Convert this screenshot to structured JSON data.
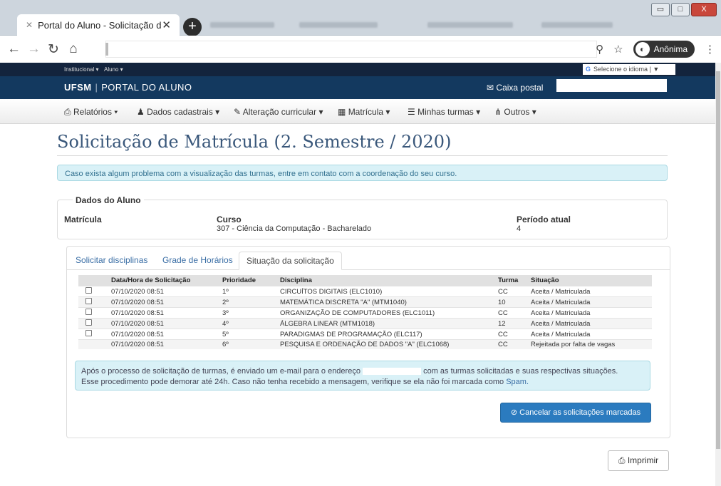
{
  "browser": {
    "tab_title": "Portal do Aluno - Solicitação de M",
    "new_tab_icon": "+",
    "incognito_label": "Anônima",
    "window_buttons": {
      "minimize": "▭",
      "maximize": "□",
      "close": "X"
    }
  },
  "utility": {
    "institucional": "Institucional ▾",
    "aluno": "Aluno ▾",
    "language_select": "Selecione o idioma | ▼"
  },
  "brand": {
    "ufsm": "UFSM",
    "portal": "PORTAL DO ALUNO",
    "caixa_postal": "Caixa postal"
  },
  "menu": [
    {
      "label": "Relatórios ▾"
    },
    {
      "label": "Dados cadastrais ▾"
    },
    {
      "label": "Alteração curricular ▾"
    },
    {
      "label": "Matrícula ▾"
    },
    {
      "label": "Minhas turmas ▾"
    },
    {
      "label": "Outros ▾"
    }
  ],
  "page": {
    "title": "Solicitação de Matrícula (2. Semestre / 2020)",
    "alert_top": "Caso exista algum problema com a visualização das turmas, entre em contato com a coordenação do seu curso."
  },
  "dados": {
    "legend": "Dados do Aluno",
    "matricula_label": "Matrícula",
    "curso_label": "Curso",
    "curso_value": "307 - Ciência da Computação - Bacharelado",
    "periodo_label": "Período atual",
    "periodo_value": "4"
  },
  "tabs": [
    "Solicitar disciplinas",
    "Grade de Horários",
    "Situação da solicitação"
  ],
  "table": {
    "headers": [
      "Data/Hora de Solicitação",
      "Prioridade",
      "Disciplina",
      "Turma",
      "Situação"
    ],
    "rows": [
      {
        "data": "07/10/2020 08:51",
        "prioridade": "1º",
        "disciplina": "CIRCUÍTOS DIGITAIS (ELC1010)",
        "turma": "CC",
        "situacao": "Aceita / Matriculada",
        "checkbox": true
      },
      {
        "data": "07/10/2020 08:51",
        "prioridade": "2º",
        "disciplina": "MATEMÁTICA DISCRETA \"A\" (MTM1040)",
        "turma": "10",
        "situacao": "Aceita / Matriculada",
        "checkbox": true
      },
      {
        "data": "07/10/2020 08:51",
        "prioridade": "3º",
        "disciplina": "ORGANIZAÇÃO DE COMPUTADORES (ELC1011)",
        "turma": "CC",
        "situacao": "Aceita / Matriculada",
        "checkbox": true
      },
      {
        "data": "07/10/2020 08:51",
        "prioridade": "4º",
        "disciplina": "ÁLGEBRA LINEAR (MTM1018)",
        "turma": "12",
        "situacao": "Aceita / Matriculada",
        "checkbox": true
      },
      {
        "data": "07/10/2020 08:51",
        "prioridade": "5º",
        "disciplina": "PARADIGMAS DE PROGRAMAÇÃO (ELC117)",
        "turma": "CC",
        "situacao": "Aceita / Matriculada",
        "checkbox": true
      },
      {
        "data": "07/10/2020 08:51",
        "prioridade": "6º",
        "disciplina": "PESQUISA E ORDENAÇÃO DE DADOS \"A\" (ELC1068)",
        "turma": "CC",
        "situacao": "Rejeitada por falta de vagas",
        "checkbox": false
      }
    ]
  },
  "info": {
    "part1": "Após o processo de solicitação de turmas, é enviado um e-mail para o endereço",
    "part2": "com as turmas solicitadas e suas respectivas situações.",
    "part3": "Esse procedimento pode demorar até 24h. Caso não tenha recebido a mensagem, verifique se ela não foi marcada como",
    "spam": "Spam."
  },
  "buttons": {
    "cancel": "Cancelar as solicitações marcadas",
    "print": "Imprimir"
  },
  "colors": {
    "accepted": "#2e9a4a",
    "rejected": "#c9302c",
    "brand_bar": "#13395f",
    "primary_button": "#2b7bbf"
  }
}
